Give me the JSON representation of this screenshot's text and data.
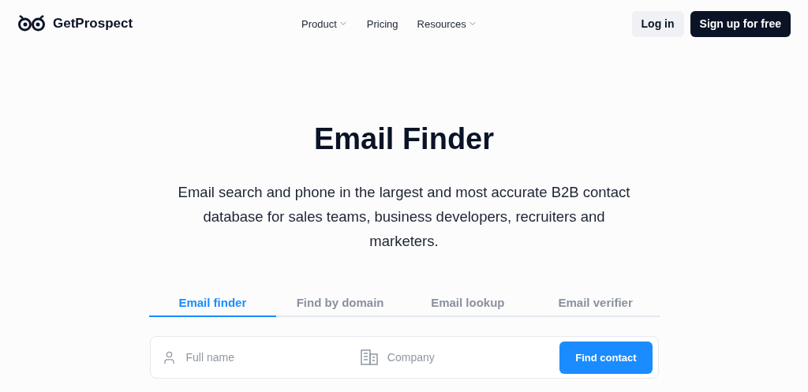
{
  "header": {
    "logo": "GetProspect",
    "nav": [
      {
        "label": "Product",
        "dropdown": true
      },
      {
        "label": "Pricing",
        "dropdown": false
      },
      {
        "label": "Resources",
        "dropdown": true
      }
    ],
    "login": "Log in",
    "signup": "Sign up for free"
  },
  "hero": {
    "title": "Email Finder",
    "subtitle": "Email search and phone in the largest and most accurate B2B contact database for sales teams, business developers, recruiters and marketers."
  },
  "tabs": [
    {
      "label": "Email finder",
      "selected": true
    },
    {
      "label": "Find by domain",
      "selected": false
    },
    {
      "label": "Email lookup",
      "selected": false
    },
    {
      "label": "Email verifier",
      "selected": false
    }
  ],
  "search": {
    "fields": [
      {
        "kind": "person",
        "placeholder": "Full name"
      },
      {
        "kind": "company",
        "placeholder": "Company"
      }
    ],
    "button": "Find contact"
  }
}
